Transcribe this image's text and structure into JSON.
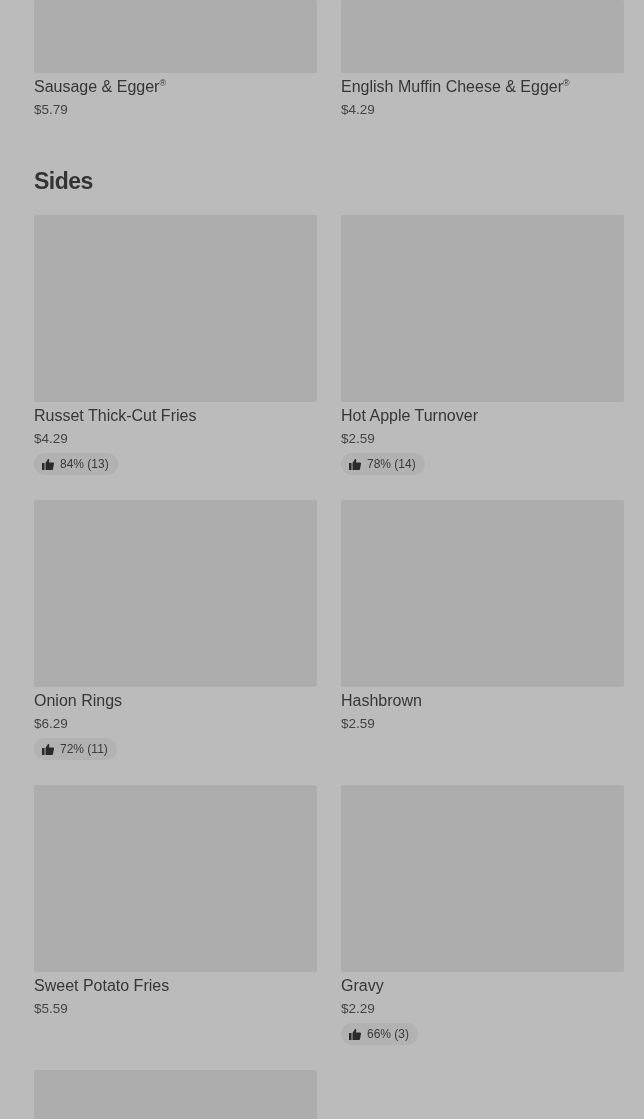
{
  "top_items": [
    {
      "kind": "item",
      "name": "Sausage & Egger$^{®}$",
      "price": "$5.79"
    },
    {
      "kind": "item",
      "name": "English Muffin Cheese & Egger$^{®}$",
      "price": "$4.29"
    }
  ],
  "sections": [
    {
      "title": "Sides",
      "items": [
        {
          "kind": "item",
          "name": "Russet Thick-Cut Fries",
          "price": "$4.29",
          "rating": "84% (13)"
        },
        {
          "kind": "item",
          "name": "Hot Apple Turnover",
          "price": "$2.59",
          "rating": "78% (14)"
        },
        {
          "kind": "item",
          "name": "Onion Rings",
          "price": "$6.29",
          "rating": "72% (11)"
        },
        {
          "kind": "item",
          "name": "Hashbrown",
          "price": "$2.59"
        },
        {
          "kind": "item",
          "name": "Sweet Potato Fries",
          "price": "$5.59"
        },
        {
          "kind": "item",
          "name": "Gravy",
          "price": "$2.29",
          "rating": "66% (3)"
        },
        {
          "kind": "image_only"
        }
      ]
    }
  ]
}
